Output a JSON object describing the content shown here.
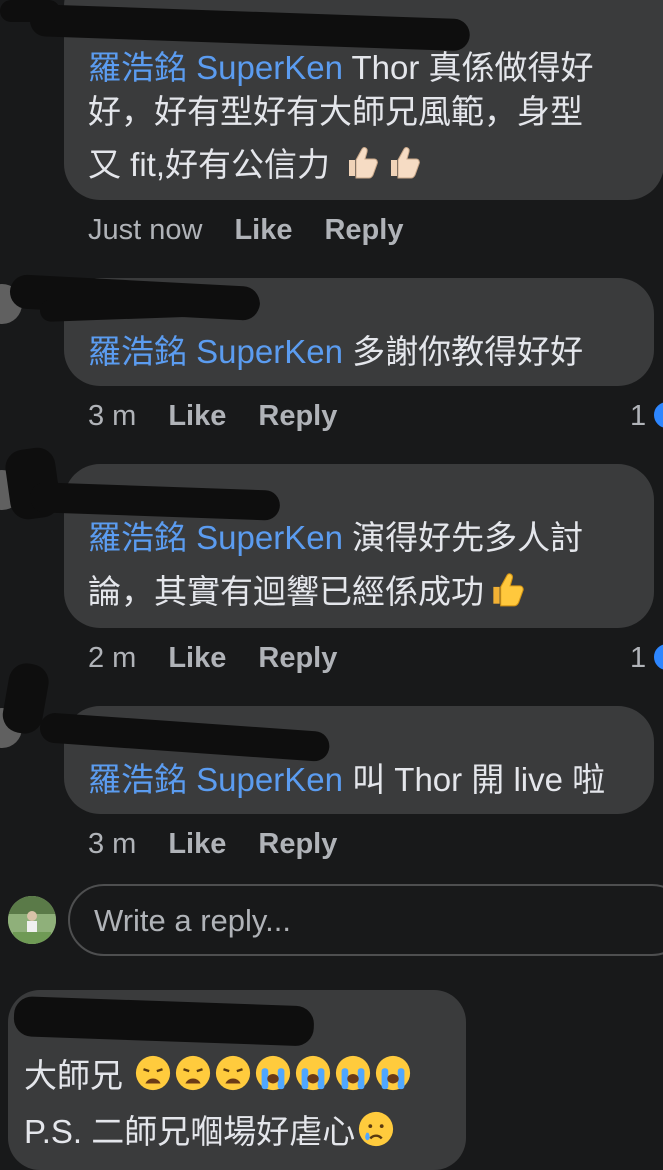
{
  "thread": {
    "comments": [
      {
        "mention": "羅浩銘 SuperKen",
        "line1": " Thor 真係做得好",
        "line2": "好，好有型好有大師兄風範，身型",
        "line3": "又 fit,好有公信力",
        "emoji": "thumbs-up-light x2",
        "time": "Just now",
        "like": "Like",
        "reply": "Reply"
      },
      {
        "mention": "羅浩銘 SuperKen",
        "line1": " 多謝你教得好好",
        "time": "3 m",
        "like": "Like",
        "reply": "Reply",
        "reaction_count": "1"
      },
      {
        "mention": "羅浩銘 SuperKen",
        "line1": " 演得好先多人討",
        "line2": "論，其實有迴響已經係成功",
        "emoji": "thumbs-up-yellow",
        "time": "2 m",
        "like": "Like",
        "reply": "Reply",
        "reaction_count": "1"
      },
      {
        "mention": "羅浩銘 SuperKen",
        "line1": " 叫 Thor 開 live 啦",
        "time": "3 m",
        "like": "Like",
        "reply": "Reply"
      }
    ],
    "reply_box": {
      "placeholder": "Write a reply..."
    },
    "next_comment": {
      "line1": "大師兄",
      "line1_emojis": "weary x3, loudly-crying x4",
      "line2": "P.S. 二師兄嗰場好虐心",
      "line2_emoji": "crying-face"
    }
  },
  "colors": {
    "background": "#18191a",
    "bubble": "#3a3b3c",
    "mention": "#5b9cf0",
    "meta": "#b0b3b8",
    "text": "#e4e6eb"
  }
}
